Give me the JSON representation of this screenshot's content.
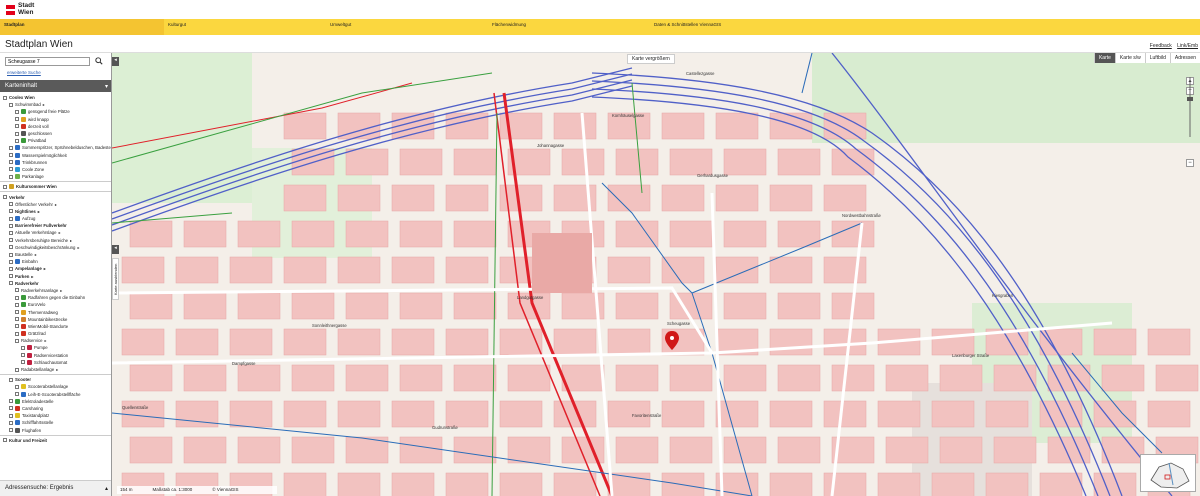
{
  "header": {
    "logo_line1": "Stadt",
    "logo_line2": "Wien",
    "nav": [
      "Stadtplan",
      "Kulturgut",
      "Umweltgut",
      "Flächenwidmung",
      "Daten & Schnittstellen ViennaGIS"
    ],
    "title": "Stadtplan Wien",
    "feedback": "Feedback",
    "link": "Link/Emb"
  },
  "sidebar": {
    "search_value": "Scheugasse 7",
    "advanced_search": "erweiterte Suche",
    "panel_title": "Karteninhalt",
    "tree": [
      {
        "label": "Coolex Wien",
        "bold": true,
        "indent": 0
      },
      {
        "label": "Schwimmbad",
        "indent": 1,
        "arrow": true
      },
      {
        "label": "genügend freie Plätze",
        "indent": 2,
        "color": "#3a9a3a"
      },
      {
        "label": "wird knapp",
        "indent": 2,
        "color": "#e0a020"
      },
      {
        "label": "derzeit voll",
        "indent": 2,
        "color": "#d03020"
      },
      {
        "label": "geschlossen",
        "indent": 2,
        "color": "#555555"
      },
      {
        "label": "Privatbad",
        "indent": 2,
        "color": "#3a9a3a"
      },
      {
        "label": "Sommerspritzer, Sprühnebelduschen, Badestellen",
        "indent": 1,
        "color": "#2b6cc4"
      },
      {
        "label": "Wasserspielmöglichkeit",
        "indent": 1,
        "color": "#2b6cc4"
      },
      {
        "label": "Trinkbrunnen",
        "indent": 1,
        "color": "#2b6cc4"
      },
      {
        "label": "Coole Zone",
        "indent": 1,
        "color": "#2b9bd4"
      },
      {
        "label": "Parkanlage",
        "indent": 1,
        "color": "#6cb04a"
      },
      {
        "sep": true
      },
      {
        "label": "Kultursommer Wien",
        "bold": true,
        "indent": 0,
        "color": "#d0a020"
      },
      {
        "sep": true
      },
      {
        "label": "Verkehr",
        "bold": true,
        "indent": 0
      },
      {
        "label": "Öffentlicher Verkehr",
        "indent": 1,
        "arrow": true
      },
      {
        "label": "Nightlines",
        "bold": true,
        "indent": 1,
        "arrow": true
      },
      {
        "label": "Aufzug",
        "indent": 1,
        "color": "#2b6cc4"
      },
      {
        "label": "Barrierefreier Fußverkehr",
        "bold": true,
        "indent": 1
      },
      {
        "label": "Aktuelle Verkehrslage",
        "indent": 1,
        "arrow": true
      },
      {
        "label": "Verkehrsberuhigte Bereiche",
        "indent": 1,
        "arrow": true
      },
      {
        "label": "Geschwindigkeitsbeschränkung",
        "indent": 1,
        "arrow": true
      },
      {
        "label": "Baustelle",
        "indent": 1,
        "arrow": true
      },
      {
        "label": "Einbahn",
        "indent": 1,
        "color": "#2b6cc4"
      },
      {
        "label": "Ampelanlage",
        "bold": true,
        "indent": 1,
        "arrow": true
      },
      {
        "label": "Parken",
        "bold": true,
        "indent": 1,
        "arrow": true
      },
      {
        "label": "Radverkehr",
        "bold": true,
        "indent": 1
      },
      {
        "label": "Radverkehrsanlage",
        "indent": 2,
        "arrow": true
      },
      {
        "label": "Radfahren gegen die Einbahn",
        "indent": 2,
        "color": "#3a9a3a"
      },
      {
        "label": "EuroVelo",
        "indent": 2,
        "color": "#3a9a3a"
      },
      {
        "label": "Themenradweg",
        "indent": 2,
        "color": "#e0a020"
      },
      {
        "label": "Mountainbikestrecke",
        "indent": 2,
        "color": "#d08030"
      },
      {
        "label": "WienMobil-Standorte",
        "indent": 2,
        "color": "#d03020"
      },
      {
        "label": "Grätzlrad",
        "indent": 2,
        "color": "#d03020"
      },
      {
        "label": "Radservice",
        "indent": 2,
        "arrow": true
      },
      {
        "label": "Pumpe",
        "indent": 3,
        "color": "#c02040"
      },
      {
        "label": "Radservicestation",
        "indent": 3,
        "color": "#c02040"
      },
      {
        "label": "Schlauchautomat",
        "indent": 3,
        "color": "#c02040"
      },
      {
        "label": "Radabstellanlage",
        "indent": 2,
        "arrow": true
      },
      {
        "sep": true
      },
      {
        "label": "Scooter",
        "bold": true,
        "indent": 1
      },
      {
        "label": "Scooterabstellanlage",
        "indent": 2,
        "color": "#e0c020"
      },
      {
        "label": "Leih-E-Scooterabstellfläche",
        "indent": 2,
        "color": "#2b6cc4"
      },
      {
        "label": "Elektroladestelle",
        "indent": 1,
        "color": "#3a9a3a"
      },
      {
        "label": "Carsharing",
        "indent": 1,
        "color": "#d03020"
      },
      {
        "label": "Taxistandplatz",
        "indent": 1,
        "color": "#e0c020"
      },
      {
        "label": "Schifffahrtsstelle",
        "indent": 1,
        "color": "#2b6cc4"
      },
      {
        "label": "Flughafen",
        "indent": 1,
        "color": "#555555"
      },
      {
        "sep": true
      },
      {
        "label": "Kultur und Freizeit",
        "bold": true,
        "indent": 0
      }
    ],
    "footer": "Adressensuche: Ergebnis"
  },
  "map": {
    "enlarge": "Karte vergrößern",
    "tabs": [
      "Karte",
      "Karte s/w",
      "Luftbild",
      "Adressen"
    ],
    "active_tab": "Karte",
    "side_tab": "Karte ausblenden",
    "scale": "154 m",
    "scale_ratio": "Maßstab ca. 1:3000",
    "copyright": "© ViennaGIS",
    "streets": [
      {
        "text": "Castellezgasse"
      },
      {
        "text": "Nordwestbahnstraße"
      },
      {
        "text": "Johannagasse"
      },
      {
        "text": "Kornhäuselgasse"
      },
      {
        "text": "Gerhardusgasse"
      },
      {
        "text": "Landgutgasse"
      },
      {
        "text": "Scheugasse"
      },
      {
        "text": "Dampfgasse"
      },
      {
        "text": "Favoritenstraße"
      },
      {
        "text": "Laxenburger Straße"
      },
      {
        "text": "Gudrunstraße"
      },
      {
        "text": "Sonnleithnergasse"
      },
      {
        "text": "Kiesgraben"
      },
      {
        "text": "Quellenstraße"
      }
    ]
  },
  "colors": {
    "nav_bg": "#fbd73f",
    "tram": "#e0202a",
    "rail": "#5060c8",
    "building": "#f2c2c0",
    "park": "#d8ecd0"
  }
}
